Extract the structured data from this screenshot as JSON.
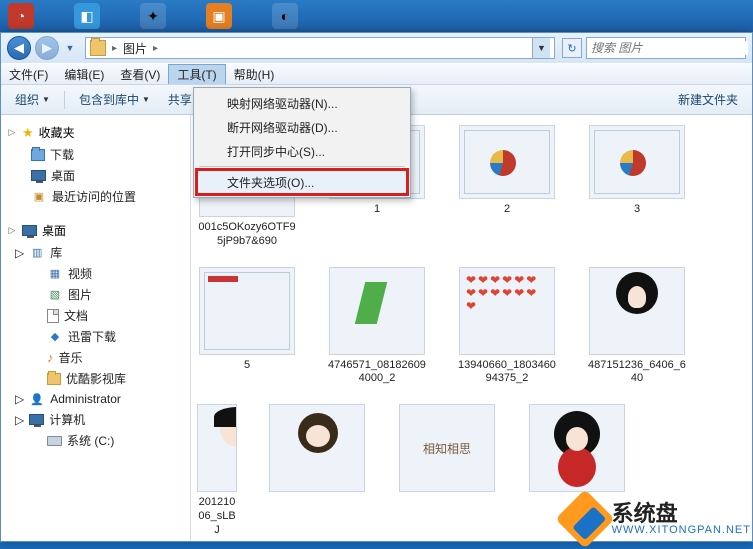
{
  "breadcrumb": {
    "folder": "图片"
  },
  "search": {
    "placeholder": "搜索 图片"
  },
  "menubar": {
    "file": "文件(F)",
    "edit": "编辑(E)",
    "view": "查看(V)",
    "tools": "工具(T)",
    "help": "帮助(H)"
  },
  "toolbar": {
    "organize": "组织",
    "include": "包含到库中",
    "sharewith": "共享",
    "newfolder": "新建文件夹"
  },
  "tools_menu": {
    "map_drive": "映射网络驱动器(N)...",
    "disconnect_drive": "断开网络驱动器(D)...",
    "open_sync": "打开同步中心(S)...",
    "folder_options": "文件夹选项(O)..."
  },
  "sidebar": {
    "favorites": "收藏夹",
    "downloads": "下载",
    "desktop": "桌面",
    "recent": "最近访问的位置",
    "desktop2": "桌面",
    "libraries": "库",
    "videos": "视频",
    "pictures": "图片",
    "documents": "文档",
    "xunlei": "迅雷下载",
    "music": "音乐",
    "youku": "优酷影视库",
    "admin": "Administrator",
    "computer": "计算机",
    "cdrive": "系统 (C:)"
  },
  "thumbs": [
    {
      "cap": "001c5OKozy6OTF95jP9b7&690"
    },
    {
      "cap": "1"
    },
    {
      "cap": "2"
    },
    {
      "cap": "3"
    },
    {
      "cap": "5"
    },
    {
      "cap": "4746571_081826094000_2"
    },
    {
      "cap": "13940660_180346094375_2"
    },
    {
      "cap": "487151236_6406_640"
    },
    {
      "cap": "20121006_sLBJ"
    },
    {
      "cap": ""
    },
    {
      "cap": ""
    },
    {
      "cap": ""
    }
  ],
  "watermark": {
    "brand": "系统盘",
    "url": "WWW.XITONGPAN.NET"
  }
}
